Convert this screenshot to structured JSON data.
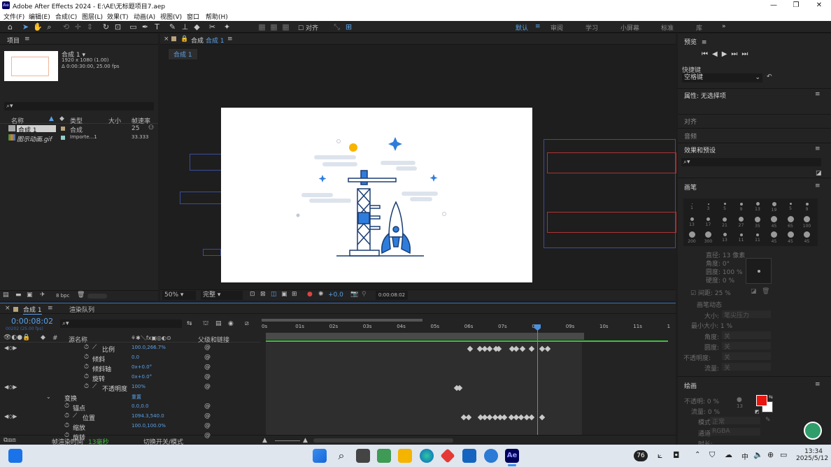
{
  "window": {
    "title": "Adobe After Effects 2024 - E:\\AE\\无标题项目7.aep",
    "app_icon": "Ae"
  },
  "menu": [
    "文件(F)",
    "编辑(E)",
    "合成(C)",
    "图层(L)",
    "效果(T)",
    "动画(A)",
    "视图(V)",
    "窗口",
    "帮助(H)"
  ],
  "toolbar": {
    "align_label": "对齐",
    "workspaces": [
      "默认",
      "审阅",
      "学习",
      "小屏幕",
      "标准",
      "库"
    ],
    "active_workspace": "默认"
  },
  "project": {
    "tab_label": "项目",
    "comp_name": "合成 1",
    "comp_size": "1920 x 1080 (1.00)",
    "comp_duration": "Δ 0:00:30:00, 25.00 fps",
    "columns": [
      "名称",
      "类型",
      "大小",
      "帧速率"
    ],
    "items": [
      {
        "name": "合成 1",
        "type": "合成",
        "size": "",
        "fps": "25"
      },
      {
        "name": "图示动画.gif",
        "type": "Importe...1",
        "size": "",
        "fps": "33.333"
      }
    ],
    "bpc": "8 bpc"
  },
  "viewer": {
    "tab_label": "合成",
    "tab_comp": "合成 1",
    "sub_tab": "合成 1",
    "zoom": "50%",
    "quality": "完整",
    "exposure": "+0.0",
    "timecode": "0:00:08:02"
  },
  "timeline": {
    "tab_label": "合成 1",
    "render_queue": "渲染队列",
    "timecode": "0:00:08:02",
    "timecode_sub": "00202 (25.00 fps)",
    "col_source": "源名称",
    "col_parent": "父级和链接",
    "ruler": [
      "0s",
      "01s",
      "02s",
      "03s",
      "04s",
      "05s",
      "06s",
      "07s",
      "08s",
      "09s",
      "10s",
      "11s",
      "1"
    ],
    "layers": [
      {
        "name": "比例",
        "value": "100.0,266.7%"
      },
      {
        "name": "倾斜",
        "value": "0.0"
      },
      {
        "name": "倾斜轴",
        "value": "0x+0.0°"
      },
      {
        "name": "旋转",
        "value": "0x+0.0°"
      },
      {
        "name": "不透明度",
        "value": "100%"
      },
      {
        "name": "变换",
        "value": "重置"
      },
      {
        "name": "锚点",
        "value": "0.0,0.0"
      },
      {
        "name": "位置",
        "value": "1094.3,540.0"
      },
      {
        "name": "缩放",
        "value": "100.0,100.0%"
      },
      {
        "name": "旋转",
        "value": ""
      }
    ],
    "footer_render_label": "帧渲染时间",
    "footer_render_value": "13毫秒",
    "footer_toggle": "切换开关/模式"
  },
  "right": {
    "preview_label": "预览",
    "shortcut_label": "快捷键",
    "shortcut_value": "空格键",
    "properties_label": "属性: 无选择项",
    "align_label": "对齐",
    "audio_label": "音频",
    "effects_label": "效果和预设",
    "brushes_label": "画笔",
    "brush_sizes": [
      "1",
      "3",
      "5",
      "9",
      "13",
      "19",
      "5",
      "9",
      "13",
      "17",
      "21",
      "27",
      "35",
      "45",
      "65",
      "100",
      "200",
      "300",
      "13",
      "11",
      "11",
      "45",
      "45",
      "45"
    ],
    "brush_props": [
      {
        "label": "直径:",
        "value": "13 像素"
      },
      {
        "label": "角度:",
        "value": "0°"
      },
      {
        "label": "圆度:",
        "value": "100 %"
      },
      {
        "label": "硬度:",
        "value": "0 %"
      }
    ],
    "spacing_label": "间距:",
    "spacing_value": "25 %",
    "brush_dynamics": "画笔动态",
    "dyn_size_label": "大小:",
    "dyn_size_value": "笔尖压力",
    "dyn_min_label": "最小大小:",
    "dyn_min_value": "1 %",
    "dyn_angle_label": "角度:",
    "dyn_round_label": "圆度:",
    "dyn_opacity_label": "不透明度:",
    "dyn_flow_label": "流量:",
    "dyn_off": "关",
    "paint_label": "绘画",
    "paint_opacity": "不透明: 0 %",
    "paint_flow": "流量: 0 %",
    "paint_mode_label": "模式:",
    "paint_mode": "正常",
    "paint_channel_label": "通道:",
    "paint_channel": "RGBA",
    "paint_duration_label": "时长:",
    "paint_value": "13",
    "fg_color": "#e8160f",
    "bg_color": "#ffffff"
  },
  "taskbar": {
    "weather": "76",
    "ime": "中",
    "time": "13:34",
    "date": "2025/5/12"
  }
}
